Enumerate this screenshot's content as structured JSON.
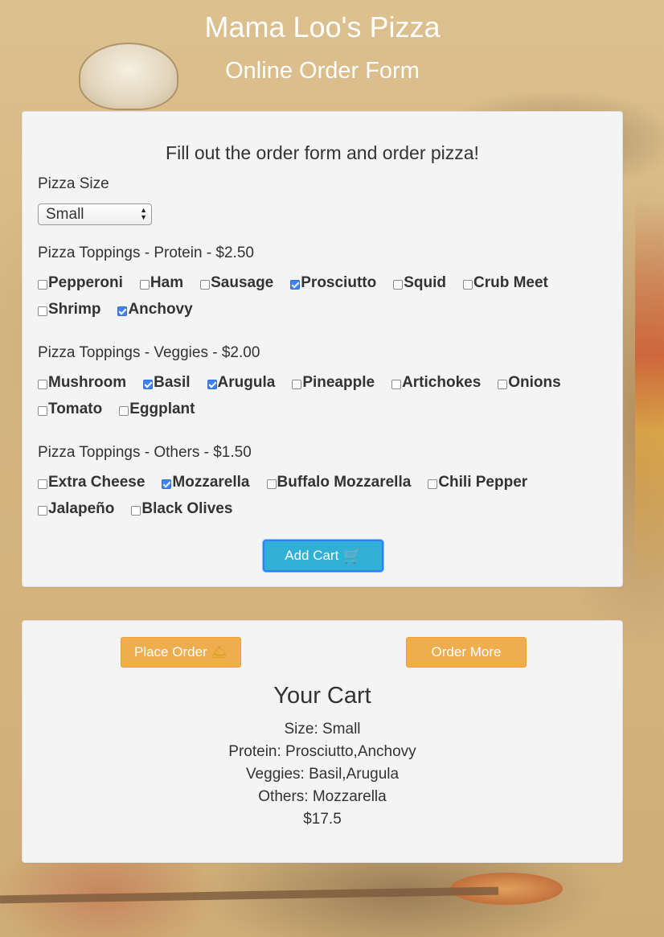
{
  "header": {
    "title": "Mama Loo's Pizza",
    "subtitle": "Online Order Form"
  },
  "form": {
    "heading": "Fill out the order form and order pizza!",
    "size_label": "Pizza Size",
    "size_selected": "Small",
    "protein_label": "Pizza Toppings - Protein - $2.50",
    "protein_options": [
      {
        "label": "Pepperoni",
        "checked": false
      },
      {
        "label": "Ham",
        "checked": false
      },
      {
        "label": "Sausage",
        "checked": false
      },
      {
        "label": "Prosciutto",
        "checked": true
      },
      {
        "label": "Squid",
        "checked": false
      },
      {
        "label": "Crub Meet",
        "checked": false
      },
      {
        "label": "Shrimp",
        "checked": false
      },
      {
        "label": "Anchovy",
        "checked": true
      }
    ],
    "veggie_label": "Pizza Toppings - Veggies - $2.00",
    "veggie_options": [
      {
        "label": "Mushroom",
        "checked": false
      },
      {
        "label": "Basil",
        "checked": true
      },
      {
        "label": "Arugula",
        "checked": true
      },
      {
        "label": "Pineapple",
        "checked": false
      },
      {
        "label": "Artichokes",
        "checked": false
      },
      {
        "label": "Onions",
        "checked": false
      },
      {
        "label": "Tomato",
        "checked": false
      },
      {
        "label": "Eggplant",
        "checked": false
      }
    ],
    "others_label": "Pizza Toppings - Others - $1.50",
    "others_options": [
      {
        "label": "Extra Cheese",
        "checked": false
      },
      {
        "label": "Mozzarella",
        "checked": true
      },
      {
        "label": "Buffalo Mozzarella",
        "checked": false
      },
      {
        "label": "Chili Pepper",
        "checked": false
      },
      {
        "label": "Jalapeño",
        "checked": false
      },
      {
        "label": "Black Olives",
        "checked": false
      }
    ],
    "add_cart_label": "Add Cart",
    "add_cart_icon": "shopping-cart-icon"
  },
  "cart": {
    "place_order_label": "Place Order",
    "place_order_icon": "bell-icon",
    "order_more_label": "Order More",
    "title": "Your Cart",
    "size_line": "Size: Small",
    "protein_line": "Protein: Prosciutto,Anchovy",
    "veggies_line": "Veggies: Basil,Arugula",
    "others_line": "Others: Mozzarella",
    "total": "$17.5"
  },
  "colors": {
    "accent_checkbox": "#3d85f4",
    "add_cart_button": "#31b0d5",
    "orange_button": "#f0ad4e",
    "panel": "#f4f4f4"
  }
}
